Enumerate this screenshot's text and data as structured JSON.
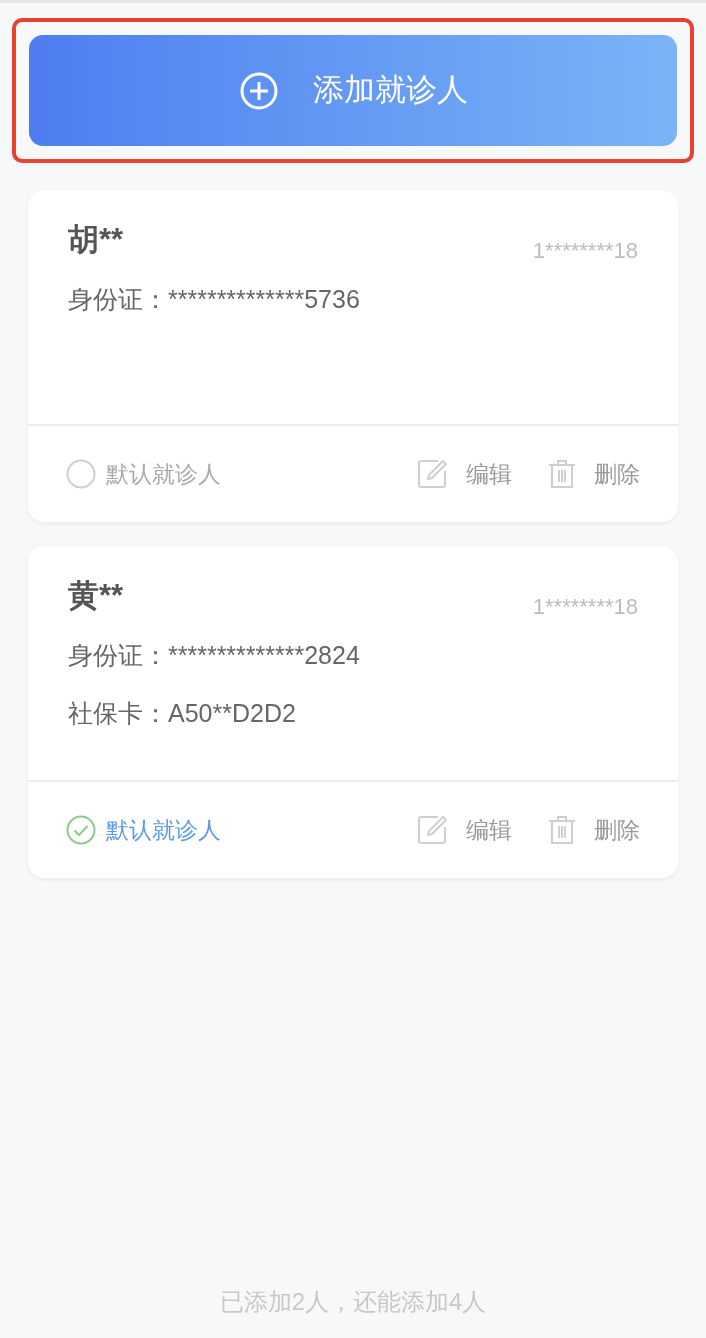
{
  "add_button": {
    "label": "添加就诊人",
    "highlighted": true
  },
  "patients": [
    {
      "name": "胡**",
      "phone": "1********18",
      "details": [
        "身份证：**************5736"
      ],
      "default_label": "默认就诊人",
      "is_default": false,
      "edit_label": "编辑",
      "delete_label": "删除"
    },
    {
      "name": "黄**",
      "phone": "1********18",
      "details": [
        "身份证：**************2824",
        "社保卡：A50**D2D2"
      ],
      "default_label": "默认就诊人",
      "is_default": true,
      "edit_label": "编辑",
      "delete_label": "删除"
    }
  ],
  "footer_note": "已添加2人，还能添加4人"
}
